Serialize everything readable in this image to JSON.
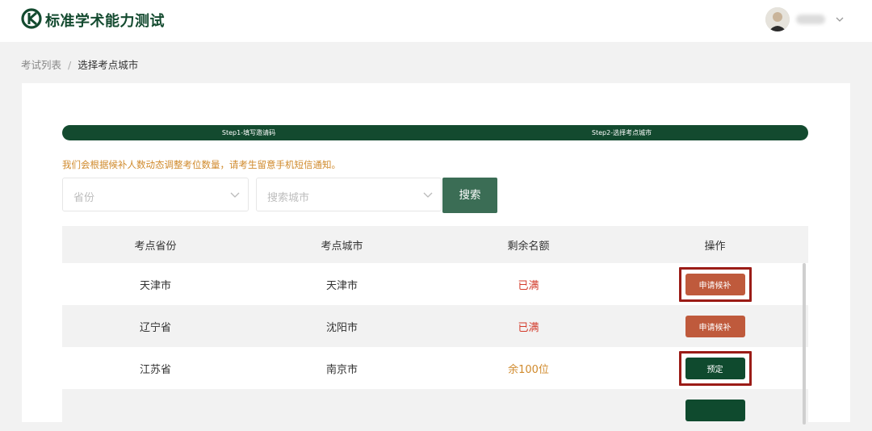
{
  "header": {
    "brand": "标准学术能力测试",
    "brand_color": "#134a2f"
  },
  "breadcrumb": {
    "parent": "考试列表",
    "separator": "/",
    "current": "选择考点城市"
  },
  "steps": [
    {
      "label": "Step1-填写邀请码"
    },
    {
      "label": "Step2-选择考点城市"
    }
  ],
  "notice": "我们会根据候补人数动态调整考位数量，请考生留意手机短信通知。",
  "filters": {
    "province_placeholder": "省份",
    "city_placeholder": "搜索城市",
    "search_label": "搜索"
  },
  "table": {
    "headers": [
      "考点省份",
      "考点城市",
      "剩余名额",
      "操作"
    ],
    "rows": [
      {
        "province": "天津市",
        "city": "天津市",
        "remaining": "已满",
        "action": "申请候补"
      },
      {
        "province": "辽宁省",
        "city": "沈阳市",
        "remaining": "已满",
        "action": "申请候补"
      },
      {
        "province": "江苏省",
        "city": "南京市",
        "remaining": "余100位",
        "action": "预定"
      }
    ]
  },
  "colors": {
    "accent": "#134a2f",
    "waitlist_button": "#bf5a3c",
    "book_button": "#0f4a2e",
    "full_text": "#d33b2b",
    "available_text": "#d08a2c",
    "highlight_box": "#9b1c17"
  }
}
